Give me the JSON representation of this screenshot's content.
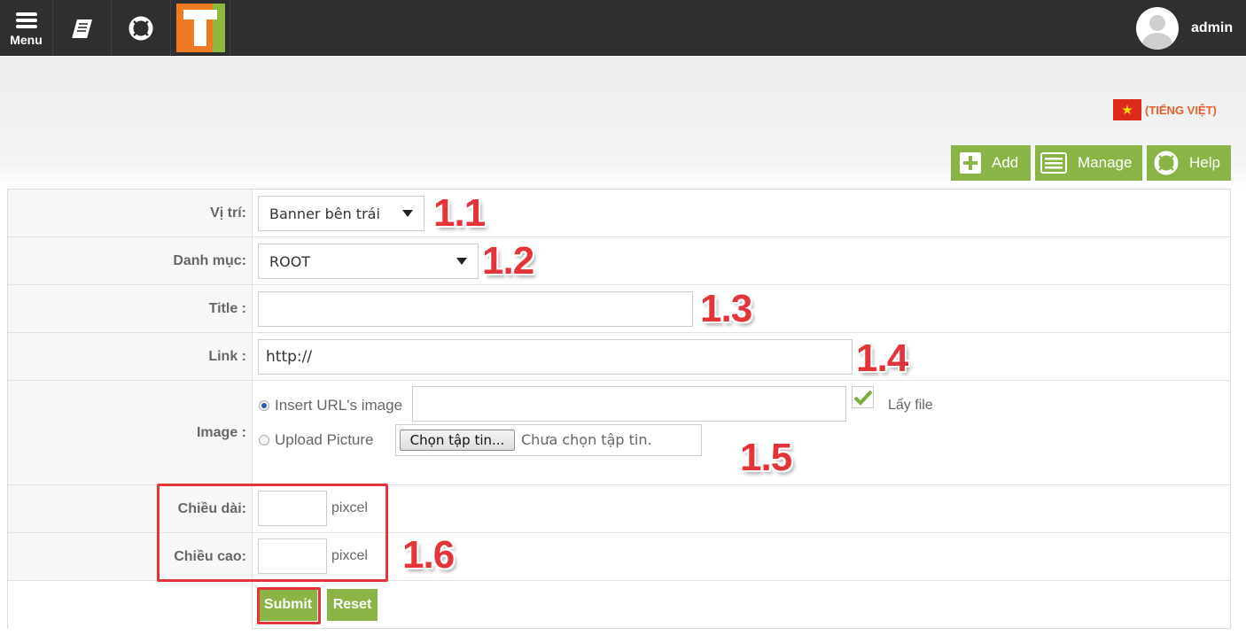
{
  "topbar": {
    "menu_label": "Menu",
    "user_name": "admin"
  },
  "language": {
    "label": "(TIẾNG VIỆT)",
    "flag_star": "★"
  },
  "toolbar": {
    "add_label": "Add",
    "manage_label": "Manage",
    "help_label": "Help"
  },
  "form": {
    "position": {
      "label": "Vị trí:",
      "value": "Banner bên trái",
      "annotation": "1.1"
    },
    "category": {
      "label": "Danh mục:",
      "value": "ROOT",
      "annotation": "1.2"
    },
    "title": {
      "label": "Title :",
      "value": "",
      "annotation": "1.3"
    },
    "link": {
      "label": "Link :",
      "value": "http://",
      "annotation": "1.4"
    },
    "image": {
      "label": "Image :",
      "url_option": "Insert URL's image",
      "url_value": "",
      "get_file_label": "Lấy file",
      "upload_option": "Upload Picture",
      "choose_file_button": "Chọn tập tin...",
      "no_file_text": "Chưa chọn tập tin.",
      "annotation": "1.5"
    },
    "width": {
      "label": "Chiều dài:",
      "value": "",
      "unit": "pixcel"
    },
    "height": {
      "label": "Chiều cao:",
      "value": "",
      "unit": "pixcel",
      "annotation": "1.6"
    },
    "submit_label": "Submit",
    "reset_label": "Reset"
  },
  "colors": {
    "accent_green": "#8ab446",
    "annotation_red": "#e4343a",
    "topbar": "#2e2f31",
    "language_orange": "#e8622a"
  }
}
